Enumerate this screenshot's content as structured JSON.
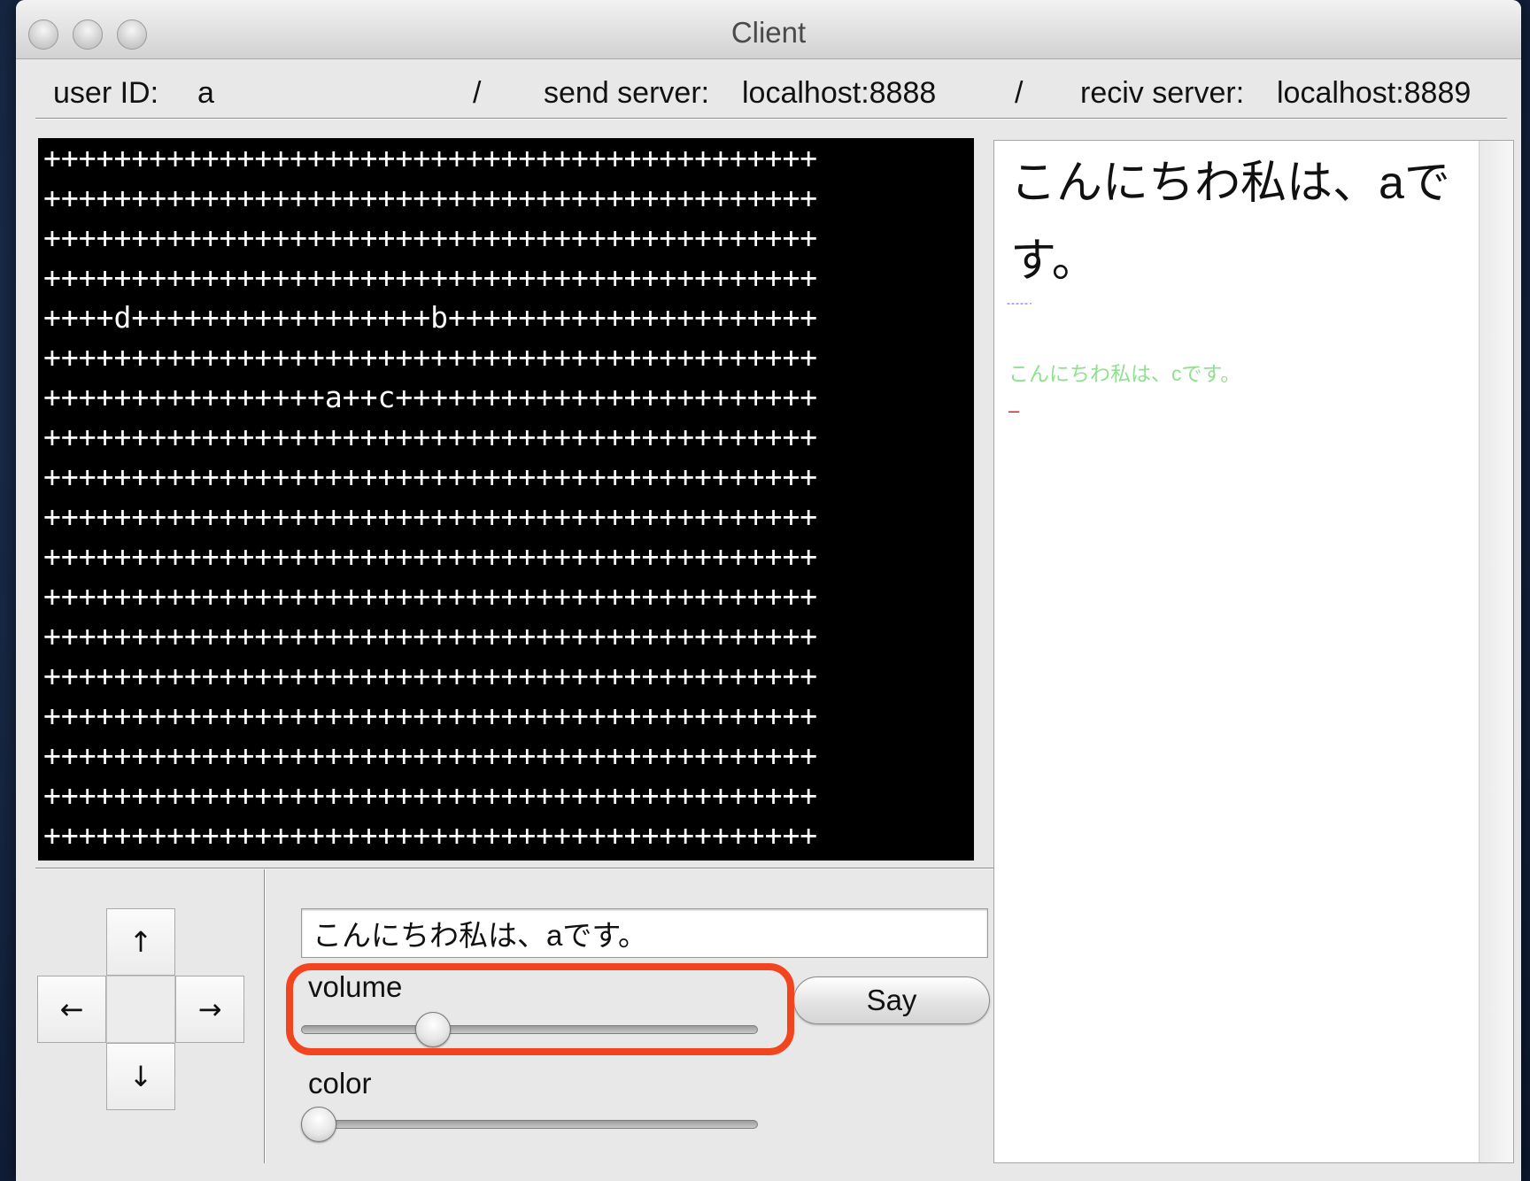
{
  "window": {
    "title": "Client"
  },
  "info": {
    "user_id_label": "user ID:",
    "user_id": "a",
    "separator": "/",
    "send_server_label": "send server:",
    "send_server": "localhost:8888",
    "recv_server_label": "reciv server:",
    "recv_server": "localhost:8889"
  },
  "grid": {
    "rows": [
      "++++++++++++++++++++++++++++++++++++++++++++",
      "++++++++++++++++++++++++++++++++++++++++++++",
      "++++++++++++++++++++++++++++++++++++++++++++",
      "++++++++++++++++++++++++++++++++++++++++++++",
      "++++d+++++++++++++++++b+++++++++++++++++++++",
      "++++++++++++++++++++++++++++++++++++++++++++",
      "++++++++++++++++a++c++++++++++++++++++++++++",
      "++++++++++++++++++++++++++++++++++++++++++++",
      "++++++++++++++++++++++++++++++++++++++++++++",
      "++++++++++++++++++++++++++++++++++++++++++++",
      "++++++++++++++++++++++++++++++++++++++++++++",
      "++++++++++++++++++++++++++++++++++++++++++++",
      "++++++++++++++++++++++++++++++++++++++++++++",
      "++++++++++++++++++++++++++++++++++++++++++++",
      "++++++++++++++++++++++++++++++++++++++++++++",
      "++++++++++++++++++++++++++++++++++++++++++++",
      "++++++++++++++++++++++++++++++++++++++++++++",
      "++++++++++++++++++++++++++++++++++++++++++++"
    ]
  },
  "controls": {
    "up": "↑",
    "down": "↓",
    "left": "←",
    "right": "→",
    "message_value": "こんにちわ私は、aです。",
    "volume_label": "volume",
    "volume_value": 0.27,
    "color_label": "color",
    "color_value": 0.0,
    "say_label": "Say"
  },
  "chat": {
    "big_message": "こんにちわ私は、aです。",
    "dash_message": "-----·",
    "green_message": "こんにちわ私は、cです。",
    "red_message": "–",
    "colors": {
      "dash": "#5544ff",
      "green": "#8fe08f",
      "red": "#e02020"
    }
  },
  "highlight_color": "#f2451f"
}
